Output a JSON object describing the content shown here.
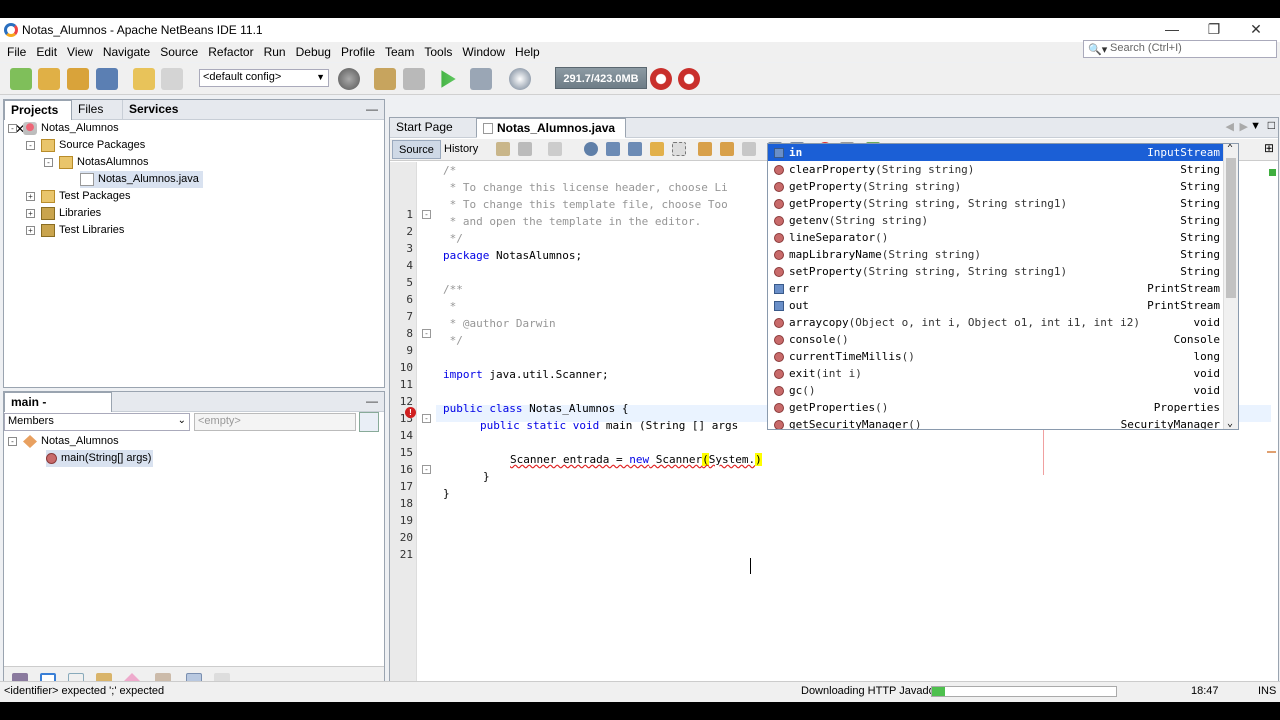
{
  "window": {
    "title": "Notas_Alumnos - Apache NetBeans IDE 11.1"
  },
  "menu": [
    "File",
    "Edit",
    "View",
    "Navigate",
    "Source",
    "Refactor",
    "Run",
    "Debug",
    "Profile",
    "Team",
    "Tools",
    "Window",
    "Help"
  ],
  "search": {
    "placeholder": "Search (Ctrl+I)"
  },
  "toolbar": {
    "config": "<default config>",
    "memory": "291.7/423.0MB"
  },
  "projects_panel": {
    "tabs": [
      "Projects",
      "Files",
      "Services"
    ],
    "tree": [
      {
        "label": "Notas_Alumnos",
        "icon": "project-icon"
      },
      {
        "label": "Source Packages",
        "icon": "package-folder-icon"
      },
      {
        "label": "NotasAlumnos",
        "icon": "package-icon"
      },
      {
        "label": "Notas_Alumnos.java",
        "icon": "java-file-icon"
      },
      {
        "label": "Test Packages",
        "icon": "package-folder-icon"
      },
      {
        "label": "Libraries",
        "icon": "library-icon"
      },
      {
        "label": "Test Libraries",
        "icon": "library-icon"
      }
    ]
  },
  "navigator": {
    "title": "main - Navigator",
    "filter": "Members",
    "empty": "<empty>",
    "tree": [
      {
        "label": "Notas_Alumnos"
      },
      {
        "label": "main(String[] args)"
      }
    ]
  },
  "editor": {
    "tabs": [
      "Start Page",
      "Notas_Alumnos.java"
    ],
    "views": [
      "Source",
      "History"
    ],
    "lines": {
      "n": [
        "1",
        "2",
        "3",
        "4",
        "5",
        "6",
        "7",
        "8",
        "9",
        "10",
        "11",
        "12",
        "13",
        "14",
        "15",
        "16",
        "17",
        "18",
        "19",
        "20",
        "21"
      ],
      "l1": "/*",
      "l2": " * To change this license header, choose Li",
      "l3": " * To change this template file, choose Too",
      "l4": " * and open the template in the editor.",
      "l5": " */",
      "l6a": "package",
      "l6b": " NotasAlumnos;",
      "l8": "/**",
      "l9": " *",
      "l10": " * @author Darwin",
      "l11": " */",
      "l13a": "import",
      "l13b": " java.util.Scanner;",
      "l15a": "public class",
      "l15b": " Notas_Alumnos {",
      "l16a": "public static void",
      "l16b": " main (String [] args",
      "l18a": "Scanner entrada = ",
      "l18b": "new",
      "l18c": " Scanner",
      "l18d": "(",
      "l18e": "System.",
      "l18f": ")",
      "l19": "}",
      "l20": "}"
    }
  },
  "completion": {
    "items": [
      {
        "name": "in",
        "params": "",
        "type": "InputStream",
        "kind": "field"
      },
      {
        "name": "clearProperty",
        "params": "(String string)",
        "type": "String",
        "kind": "method"
      },
      {
        "name": "getProperty",
        "params": "(String string)",
        "type": "String",
        "kind": "method"
      },
      {
        "name": "getProperty",
        "params": "(String string, String string1)",
        "type": "String",
        "kind": "method"
      },
      {
        "name": "getenv",
        "params": "(String string)",
        "type": "String",
        "kind": "method"
      },
      {
        "name": "lineSeparator",
        "params": "()",
        "type": "String",
        "kind": "method"
      },
      {
        "name": "mapLibraryName",
        "params": "(String string)",
        "type": "String",
        "kind": "method"
      },
      {
        "name": "setProperty",
        "params": "(String string, String string1)",
        "type": "String",
        "kind": "method"
      },
      {
        "name": "err",
        "params": "",
        "type": "PrintStream",
        "kind": "field"
      },
      {
        "name": "out",
        "params": "",
        "type": "PrintStream",
        "kind": "field"
      },
      {
        "name": "arraycopy",
        "params": "(Object o, int i, Object o1, int i1, int i2)",
        "type": "void",
        "kind": "method"
      },
      {
        "name": "console",
        "params": "()",
        "type": "Console",
        "kind": "method"
      },
      {
        "name": "currentTimeMillis",
        "params": "()",
        "type": "long",
        "kind": "method"
      },
      {
        "name": "exit",
        "params": "(int i)",
        "type": "void",
        "kind": "method"
      },
      {
        "name": "gc",
        "params": "()",
        "type": "void",
        "kind": "method"
      },
      {
        "name": "getProperties",
        "params": "()",
        "type": "Properties",
        "kind": "method"
      },
      {
        "name": "getSecurityManager",
        "params": "()",
        "type": "SecurityManager",
        "kind": "method"
      }
    ]
  },
  "status": {
    "message": "<identifier> expected ';' expected",
    "download": "Downloading HTTP Javadoc",
    "progress": 0.07,
    "time": "18:47",
    "mode": "INS"
  }
}
